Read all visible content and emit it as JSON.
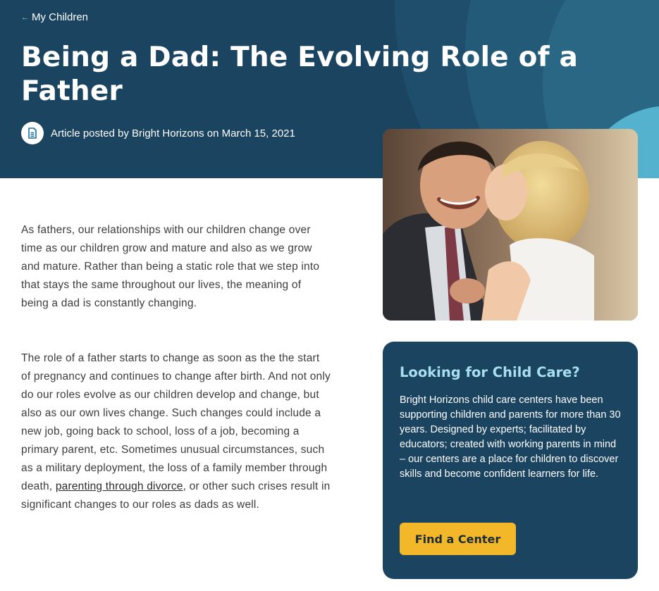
{
  "breadcrumb": {
    "arrow": "←",
    "label": "My Children"
  },
  "page": {
    "title": "Being a Dad: The Evolving Role of a Father",
    "byline": "Article posted by Bright Horizons on March 15, 2021"
  },
  "icons": {
    "byline": "document-icon"
  },
  "article": {
    "paragraph1": "As fathers, our relationships with our children change over time as our children grow and mature and also as we grow and mature. Rather than being a static role that we step into that stays the same throughout our lives, the meaning of being a dad is constantly changing.",
    "paragraph2_before_link": "The role of a father starts to change as soon as the the start of pregnancy and continues to change after birth. And not only do our roles evolve as our children develop and change, but also as our own lives change. Such changes could include a new job, going back to school, loss of a job, becoming a primary parent, etc. Sometimes unusual circumstances, such as a military deployment, the loss of a family member through death, ",
    "paragraph2_link": "parenting through divorce",
    "paragraph2_after_link": ", or other such crises result in significant changes to our roles as dads as well."
  },
  "sidebar": {
    "heading": "Looking for Child Care?",
    "body": "Bright Horizons child care centers have been supporting children and parents for more than 30 years. Designed by experts; facilitated by educators; created with working parents in mind – our centers are a place for children to discover skills and become confident learners for life.",
    "button_label": "Find a Center"
  },
  "colors": {
    "hero_bg": "#1b4461",
    "accent_light": "#54b2cf",
    "heading_accent": "#a7dff0",
    "button_bg": "#f3b72a"
  }
}
